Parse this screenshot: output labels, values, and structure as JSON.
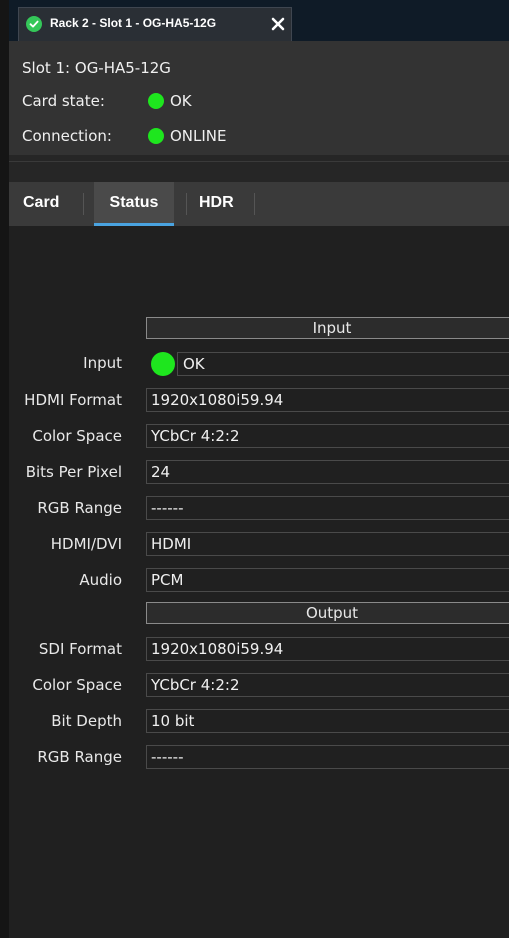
{
  "tab": {
    "title": "Rack 2 - Slot 1 - OG-HA5-12G",
    "status_icon": "check-circle-icon",
    "close_icon": "close-icon"
  },
  "header": {
    "slot": "Slot 1: OG-HA5-12G",
    "card_state_label": "Card state:",
    "card_state_value": "OK",
    "connection_label": "Connection:",
    "connection_value": "ONLINE",
    "status_color": "#1ee61e"
  },
  "page_tabs": [
    {
      "label": "Card",
      "selected": false
    },
    {
      "label": "Status",
      "selected": true
    },
    {
      "label": "HDR",
      "selected": false
    }
  ],
  "input_section": {
    "title": "Input",
    "input_label": "Input",
    "input_value": "OK",
    "fields": [
      {
        "label": "HDMI Format",
        "value": "1920x1080i59.94"
      },
      {
        "label": "Color Space",
        "value": "YCbCr 4:2:2"
      },
      {
        "label": "Bits Per Pixel",
        "value": "24"
      },
      {
        "label": "RGB Range",
        "value": "------"
      },
      {
        "label": "HDMI/DVI",
        "value": "HDMI"
      },
      {
        "label": "Audio",
        "value": "PCM"
      }
    ]
  },
  "output_section": {
    "title": "Output",
    "fields": [
      {
        "label": "SDI Format",
        "value": "1920x1080i59.94"
      },
      {
        "label": "Color Space",
        "value": "YCbCr 4:2:2"
      },
      {
        "label": "Bit Depth",
        "value": "10 bit"
      },
      {
        "label": "RGB Range",
        "value": "------"
      }
    ]
  },
  "colors": {
    "accent": "#4aa3e0",
    "tab_check": "#34c759"
  }
}
